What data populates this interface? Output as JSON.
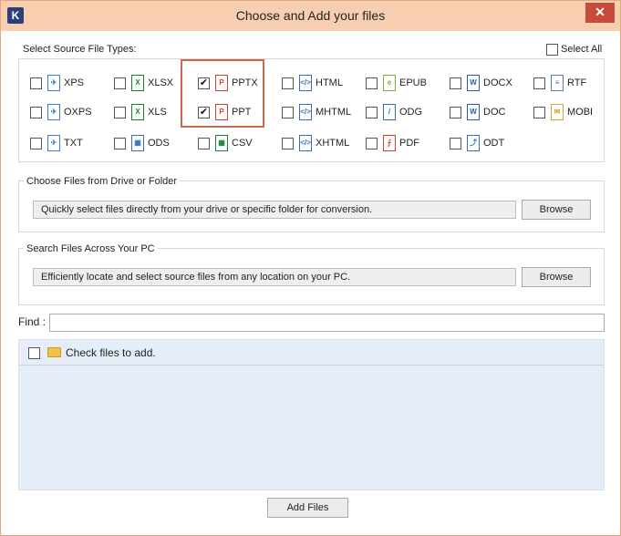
{
  "window": {
    "title": "Choose and Add your files",
    "app_icon_letter": "K",
    "close_glyph": "✕"
  },
  "source_types": {
    "label": "Select Source File Types:",
    "select_all_label": "Select All",
    "items": [
      {
        "name": "XPS",
        "checked": false,
        "icon_char": "✈",
        "icon_color": "#3a7bd5"
      },
      {
        "name": "XLSX",
        "checked": false,
        "icon_char": "X",
        "icon_color": "#1e7b3a"
      },
      {
        "name": "PPTX",
        "checked": true,
        "icon_char": "P",
        "icon_color": "#c8452b"
      },
      {
        "name": "HTML",
        "checked": false,
        "icon_char": "</>",
        "icon_color": "#3a6fb5"
      },
      {
        "name": "EPUB",
        "checked": false,
        "icon_char": "e",
        "icon_color": "#7ab33a"
      },
      {
        "name": "DOCX",
        "checked": false,
        "icon_char": "W",
        "icon_color": "#2b5aa6"
      },
      {
        "name": "RTF",
        "checked": false,
        "icon_char": "≡",
        "icon_color": "#5a7ab5"
      },
      {
        "name": "OXPS",
        "checked": false,
        "icon_char": "✈",
        "icon_color": "#3a7bd5"
      },
      {
        "name": "XLS",
        "checked": false,
        "icon_char": "X",
        "icon_color": "#1e7b3a"
      },
      {
        "name": "PPT",
        "checked": true,
        "icon_char": "P",
        "icon_color": "#c8452b"
      },
      {
        "name": "MHTML",
        "checked": false,
        "icon_char": "</>",
        "icon_color": "#3a6fb5"
      },
      {
        "name": "ODG",
        "checked": false,
        "icon_char": "/",
        "icon_color": "#2b6fb5"
      },
      {
        "name": "DOC",
        "checked": false,
        "icon_char": "W",
        "icon_color": "#2b5aa6"
      },
      {
        "name": "MOBI",
        "checked": false,
        "icon_char": "✉",
        "icon_color": "#d8a33a"
      },
      {
        "name": "TXT",
        "checked": false,
        "icon_char": "✈",
        "icon_color": "#3a7bd5"
      },
      {
        "name": "ODS",
        "checked": false,
        "icon_char": "▦",
        "icon_color": "#3a6fb5"
      },
      {
        "name": "CSV",
        "checked": false,
        "icon_char": "▦",
        "icon_color": "#1e7b3a"
      },
      {
        "name": "XHTML",
        "checked": false,
        "icon_char": "</>",
        "icon_color": "#3a6fb5"
      },
      {
        "name": "PDF",
        "checked": false,
        "icon_char": "⨍",
        "icon_color": "#c8452b"
      },
      {
        "name": "ODT",
        "checked": false,
        "icon_char": "⤴",
        "icon_color": "#3a6fb5"
      }
    ]
  },
  "drive_section": {
    "label": "Choose Files from Drive or Folder",
    "text": "Quickly select files directly from your drive or specific folder for conversion.",
    "browse_label": "Browse"
  },
  "search_section": {
    "label": "Search Files Across Your PC",
    "text": "Efficiently locate and select source files from any location on your PC.",
    "browse_label": "Browse"
  },
  "find": {
    "label": "Find :",
    "value": ""
  },
  "files": {
    "header_label": "Check files to add."
  },
  "add_files_label": "Add Files",
  "colors": {
    "title_bar": "#f7cfb0",
    "close": "#c74b3a",
    "highlight": "#c56a4e",
    "files_bg": "#e5eef8"
  }
}
